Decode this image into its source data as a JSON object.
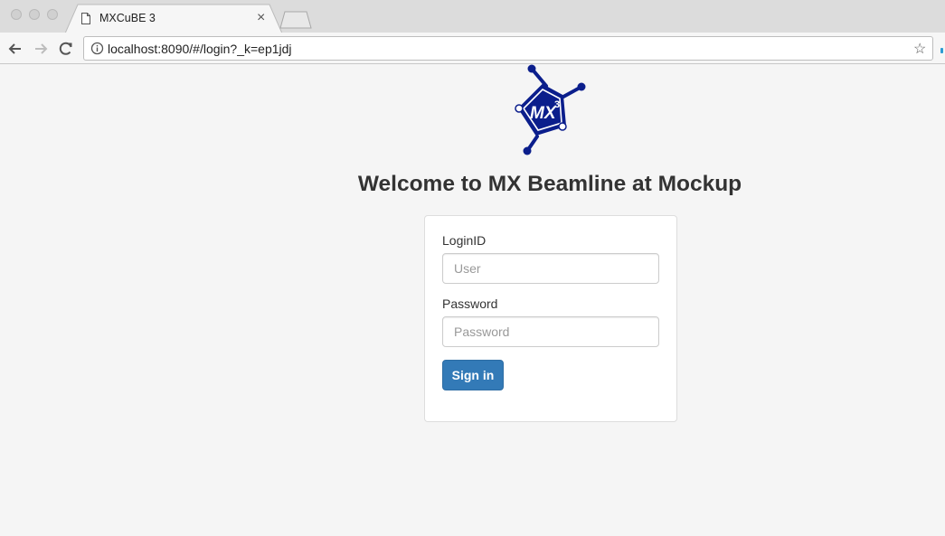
{
  "browser": {
    "tab_title": "MXCuBE 3",
    "url": "localhost:8090/#/login?_k=ep1jdj"
  },
  "logo": {
    "text": "MX",
    "superscript": "3"
  },
  "page": {
    "heading": "Welcome to MX Beamline at Mockup"
  },
  "login_form": {
    "login_label": "LoginID",
    "login_placeholder": "User",
    "password_label": "Password",
    "password_placeholder": "Password",
    "submit_label": "Sign in"
  },
  "colors": {
    "primary_button": "#337ab7",
    "logo_blue": "#0b1e8c",
    "page_background": "#f5f5f5"
  }
}
